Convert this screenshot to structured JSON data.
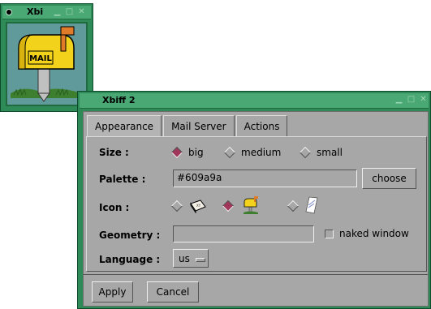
{
  "mini_window": {
    "title": "Xbi",
    "title_buttons": [
      "minimize-icon",
      "maximize-icon",
      "close-icon"
    ],
    "mailbox_label": "MAIL"
  },
  "main_window": {
    "title": "Xbiff 2",
    "tabs": [
      {
        "label": "Appearance",
        "active": true
      },
      {
        "label": "Mail Server",
        "active": false
      },
      {
        "label": "Actions",
        "active": false
      }
    ],
    "size": {
      "label": "Size :",
      "options": [
        "big",
        "medium",
        "small"
      ],
      "selected": "big"
    },
    "palette": {
      "label": "Palette :",
      "value": "#609a9a",
      "choose_label": "choose"
    },
    "icon": {
      "label": "Icon :",
      "options": [
        "envelope-icon",
        "mailbox-icon",
        "letter-icon"
      ],
      "selected": "mailbox-icon"
    },
    "geometry": {
      "label": "Geometry :",
      "value": "",
      "naked_window_label": "naked window",
      "naked_window_checked": false
    },
    "language": {
      "label": "Language :",
      "value": "us"
    },
    "apply_label": "Apply",
    "cancel_label": "Cancel"
  },
  "colors": {
    "window_frame": "#2e8b57",
    "title_bar": "#4aa874",
    "panel_bg": "#a7a7a7",
    "radio_selected": "#a0365a",
    "palette": "#609a9a"
  }
}
